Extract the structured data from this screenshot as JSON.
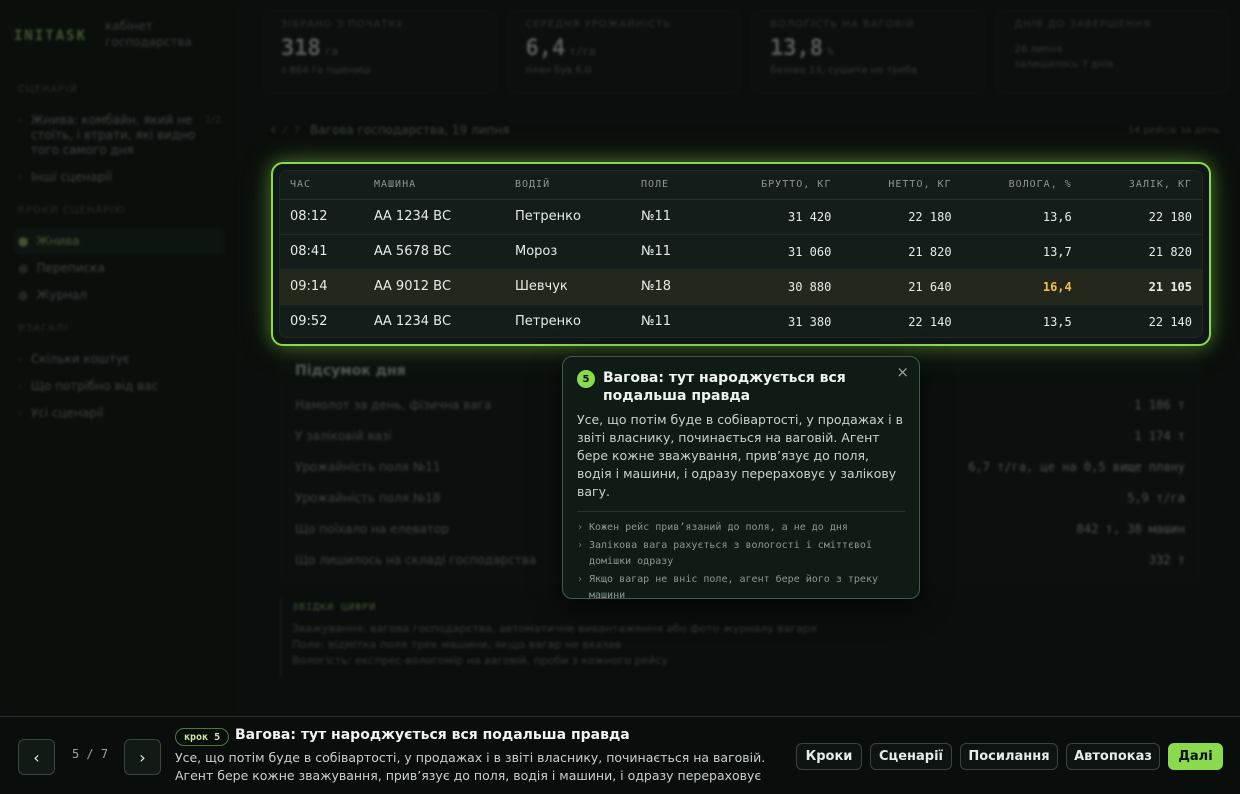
{
  "sidebar": {
    "brand": "INITASK",
    "brand_sub": "кабінет господарства",
    "section1": "СЦЕНАРІЙ",
    "scenario_item": "Жнива: комбайн, який не стоїть, і втрати, які видно того самого дня",
    "scenario_num": "1/2",
    "other_scenarios": "Інші сценарії",
    "section2": "КРОКИ СЦЕНАРІЮ",
    "steps": [
      "Жнива",
      "Переписка",
      "Журнал"
    ],
    "section3": "ВЗАГАЛІ",
    "general": [
      "Скільки коштує",
      "Що потрібно від вас",
      "Усі сценарії"
    ]
  },
  "kpis": [
    {
      "label": "ЗІБРАНО З ПОЧАТКУ",
      "value": "318",
      "unit": "га",
      "note": "з 864 га пшениці"
    },
    {
      "label": "СЕРЕДНЯ УРОЖАЙНІСТЬ",
      "value": "6,4",
      "unit": "т/га",
      "note": "план був 6,0"
    },
    {
      "label": "ВОЛОГІСТЬ НА ВАГОВІЙ",
      "value": "13,8",
      "unit": "%",
      "note": "базова 14; сушити не треба"
    },
    {
      "label": "ДНІВ ДО ЗАВЕРШЕННЯ",
      "value": "",
      "unit": "",
      "note": "26 липня",
      "note2": "залишилось 7 днів"
    }
  ],
  "crumb": {
    "pre": "4 / 7",
    "title": "Вагова господарства, 19 липня",
    "right": "14 рейсів за день"
  },
  "table": {
    "headers": [
      "ЧАС",
      "МАШИНА",
      "ВОДІЙ",
      "ПОЛЕ",
      "БРУТТО, КГ",
      "НЕТТО, КГ",
      "ВОЛОГА, %",
      "ЗАЛІК, КГ"
    ],
    "rows": [
      [
        "08:12",
        "АА 1234 ВС",
        "Петренко",
        "№11",
        "31 420",
        "22 180",
        "13,6",
        "22 180"
      ],
      [
        "08:41",
        "АА 5678 ВС",
        "Мороз",
        "№11",
        "31 060",
        "21 820",
        "13,7",
        "21 820"
      ],
      [
        "09:14",
        "АА 9012 ВС",
        "Шевчук",
        "№18",
        "30 880",
        "21 640",
        "16,4",
        "21 105"
      ],
      [
        "09:52",
        "АА 1234 ВС",
        "Петренко",
        "№11",
        "31 380",
        "22 140",
        "13,5",
        "22 140"
      ]
    ]
  },
  "summary": {
    "title": "Підсумок дня",
    "rows": [
      {
        "k": "Намолот за день, фізична вага",
        "v": "1 186 т"
      },
      {
        "k": "У заліковій вазі",
        "v": "1 174 т"
      },
      {
        "k": "Урожайність поля №11",
        "v": "6,7 т/га, це на 0,5 вище плану"
      },
      {
        "k": "Урожайність поля №18",
        "v": "5,9 т/га"
      },
      {
        "k": "Що поїхало на елеватор",
        "v": "842 т, 38 машин"
      },
      {
        "k": "Що лишилось на складі господарства",
        "v": "332 т"
      }
    ]
  },
  "sources": {
    "title": "ЗВІДКИ ЦИФРИ",
    "lines": [
      "Зважування: вагова господарства, автоматичне вивантаження або фото журналу вагаря",
      "Поле: відмітка поля трек машини, якщо вагар не вказав",
      "Вологість: експрес-вологомір на ваговій, проби з кожного рейсу"
    ]
  },
  "popover": {
    "step": "5",
    "title": "Вагова: тут народжується вся подальша правда",
    "body": "Усе, що потім буде в собівартості, у продажах і в звіті власнику, починається на ваговій. Агент бере кожне зважування, прив’язує до поля, водія і машини, і одразу перераховує у залікову вагу.",
    "bullets": [
      "Кожен рейс прив’язаний до поля, а не до дня",
      "Залікова вага рахується з вологості і сміттєвої домішки одразу",
      "Якщо вагар не вніс поле, агент бере його з треку машини"
    ],
    "close": "×"
  },
  "bottom": {
    "prev": "‹",
    "next": "›",
    "counter": "5 / 7",
    "badge": "крок 5",
    "title": "Вагова: тут народжується вся подальша правда",
    "text": "Усе, що потім буде в собівартості, у продажах і в звіті власнику, починається на ваговій. Агент бере кожне зважування, прив’язує до поля, водія і машини, і одразу перераховує у…",
    "buttons": {
      "steps": "Кроки",
      "scenarios": "Сценарії",
      "links": "Посилання",
      "autoplay": "Автопоказ",
      "next": "Далі"
    }
  },
  "colors": {
    "accent": "#8bd94f",
    "warn": "#f0c04a",
    "bg": "#0a0e0c"
  }
}
